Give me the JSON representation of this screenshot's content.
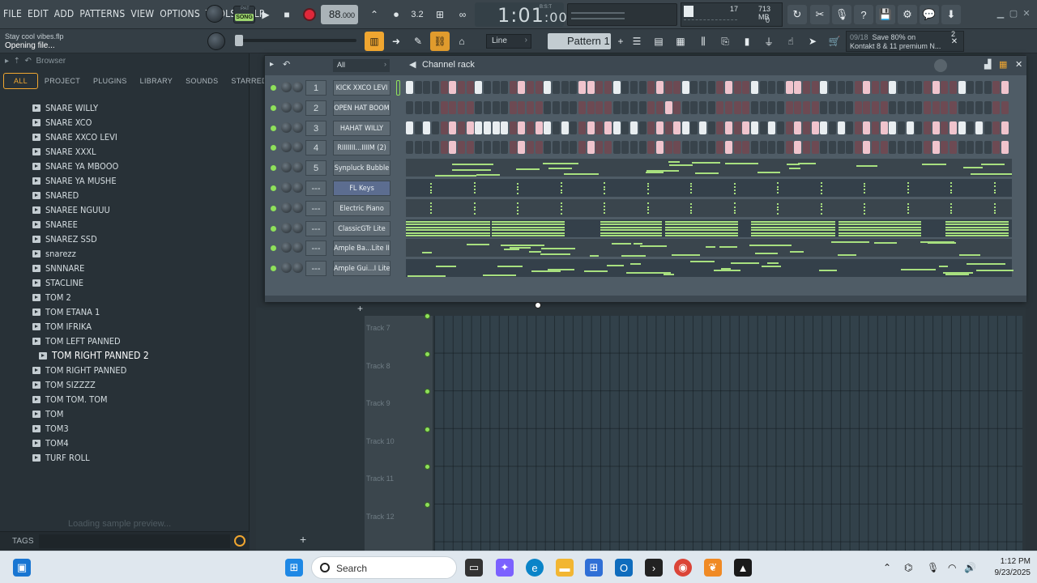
{
  "menu": [
    "FILE",
    "EDIT",
    "ADD",
    "PATTERNS",
    "VIEW",
    "OPTIONS",
    "TOOLS",
    "HELP"
  ],
  "transport": {
    "mode_label": "SONG",
    "mode_alt": "PAT",
    "tempo": "88",
    "tempo_fraction": ".000",
    "time": "1:01",
    "time_sub": ":00",
    "time_unit": "B:S:T"
  },
  "cpu": {
    "polyphony": "17",
    "memory": "713 MB",
    "value": "0"
  },
  "hint": {
    "file": "Stay cool vibes.flp",
    "status": "Opening file..."
  },
  "snap": "Line",
  "pattern": "Pattern 1",
  "promo": {
    "counter": "09/18",
    "line1": "Save 80% on",
    "line2": "Kontakt 8 & 11 premium N...",
    "badge": "2"
  },
  "browser": {
    "title": "Browser",
    "tabs": [
      "ALL",
      "PROJECT",
      "PLUGINS",
      "LIBRARY",
      "SOUNDS",
      "STARRED"
    ],
    "items": [
      "SNARE WILLY",
      "SNARE XCO",
      "SNARE XXCO LEVI",
      "SNARE XXXL",
      "SNARE YA MBOOO",
      "SNARE YA MUSHE",
      "SNARED",
      "SNAREE NGUUU",
      "SNAREE",
      "SNAREZ SSD",
      "snarezz",
      "SNNNARE",
      "STACLINE",
      "TOM 2",
      "TOM ETANA 1",
      "TOM IFRIKA",
      "TOM LEFT PANNED",
      "TOM RIGHT PANNED 2",
      "TOM RIGHT PANNED",
      "TOM SIZZZZ",
      "TOM TOM. TOM",
      "TOM",
      "TOM3",
      "TOM4",
      "TURF ROLL"
    ],
    "selected_index": 17,
    "loading": "Loading sample preview...",
    "tags_label": "TAGS"
  },
  "rack": {
    "title": "Channel rack",
    "group": "All",
    "channels": [
      {
        "num": "1",
        "name": "KICK XXCO LEVI",
        "type": "steps",
        "on": [
          0,
          5,
          8,
          13,
          16,
          20,
          21,
          24,
          29,
          32,
          37,
          40,
          44,
          45,
          48,
          53,
          56,
          61,
          64,
          69
        ]
      },
      {
        "num": "2",
        "name": "OPEN HAT BOOM",
        "type": "steps",
        "on": [
          30
        ]
      },
      {
        "num": "3",
        "name": "HAHAT WILLY",
        "type": "steps",
        "on": [
          0,
          2,
          5,
          7,
          8,
          9,
          10,
          11,
          13,
          15,
          16,
          18,
          21,
          23,
          24,
          26,
          29,
          31,
          32,
          34,
          37,
          39,
          40,
          42,
          45,
          47,
          48,
          50,
          53,
          55,
          56,
          58,
          61,
          63,
          64,
          66,
          69
        ]
      },
      {
        "num": "4",
        "name": "RIIIIIII...IIIIM (2)",
        "type": "steps",
        "on": [
          5,
          13,
          21,
          29,
          37,
          45,
          53,
          61,
          69
        ]
      },
      {
        "num": "5",
        "name": "Synpluck Bubble",
        "type": "roll"
      },
      {
        "num": "---",
        "name": "FL Keys",
        "type": "roll",
        "highlight": true
      },
      {
        "num": "---",
        "name": "Electric Piano",
        "type": "roll"
      },
      {
        "num": "---",
        "name": "ClassicGTr Lite",
        "type": "roll"
      },
      {
        "num": "---",
        "name": "Ample Ba...Lite II",
        "type": "roll"
      },
      {
        "num": "---",
        "name": "Ample Gui...I Lite",
        "type": "roll"
      }
    ]
  },
  "playlist": {
    "tracks": [
      "Track 7",
      "Track 8",
      "Track 9",
      "Track 10",
      "Track 11",
      "Track 12"
    ]
  },
  "taskbar": {
    "search": "Search",
    "time": "1:12 PM",
    "date": "9/23/2025"
  }
}
